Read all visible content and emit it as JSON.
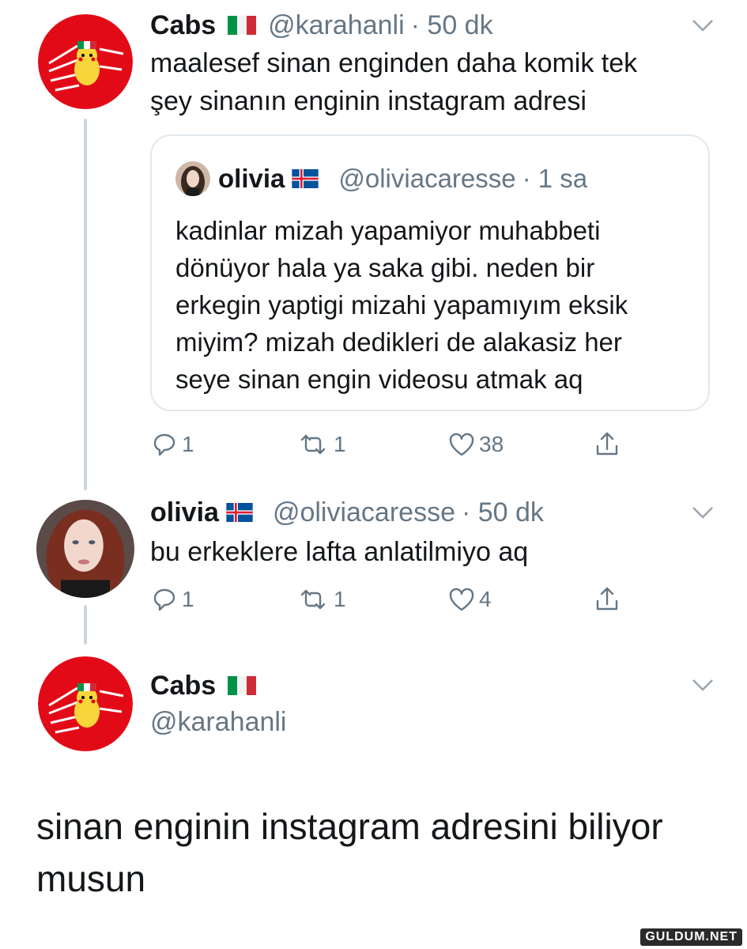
{
  "tweet1": {
    "name": "Cabs",
    "handle": "@karahanli",
    "time": "· 50 dk",
    "text_lines": [
      "maalesef sinan enginden daha komik tek",
      "şey sinanın enginin instagram adresi"
    ],
    "quote": {
      "name": "olivia",
      "handle": "@oliviacaresse",
      "time": "· 1 sa",
      "text_lines": [
        "kadinlar mizah yapamiyor muhabbeti",
        "dönüyor hala ya saka gibi. neden bir",
        "erkegin yaptigi mizahi yapamıyım eksik",
        "miyim? mizah dedikleri de alakasiz her",
        "seye sinan engin videosu atmak aq"
      ]
    },
    "actions": {
      "replies": "1",
      "retweets": "1",
      "likes": "38"
    }
  },
  "tweet2": {
    "name": "olivia",
    "handle": "@oliviacaresse",
    "time": "· 50 dk",
    "text": "bu erkeklere lafta anlatilmiyo aq",
    "actions": {
      "replies": "1",
      "retweets": "1",
      "likes": "4"
    }
  },
  "tweet3": {
    "name": "Cabs",
    "handle": "@karahanli",
    "text_lines": [
      "sinan enginin instagram adresini biliyor",
      "musun"
    ]
  },
  "watermark": "GULDUM.NET",
  "icons": {
    "reply": "reply-icon",
    "retweet": "retweet-icon",
    "like": "heart-icon",
    "share": "share-icon",
    "caret": "chevron-down-icon"
  },
  "colors": {
    "text": "#14171a",
    "muted": "#657786",
    "border": "#e1e8ed",
    "thread": "#ccd6dd",
    "avatar_red": "#e30a17"
  }
}
